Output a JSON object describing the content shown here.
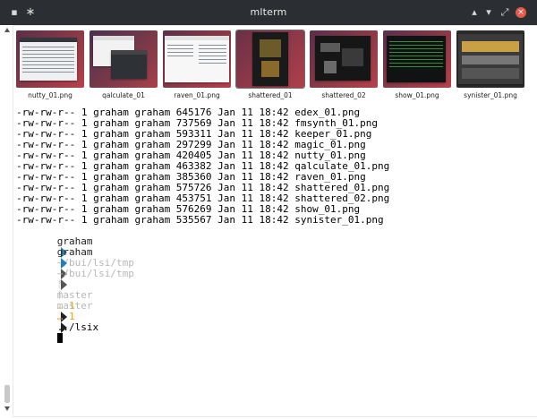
{
  "titlebar": {
    "title": "mlterm",
    "icons": [
      "app-menu-icon",
      "pin-icon",
      "chevron-up-icon",
      "chevron-down-icon",
      "restore-icon",
      "close-icon"
    ],
    "glyph_app": "▪",
    "glyph_pin": "∗",
    "glyph_up": "▴",
    "glyph_down": "▾",
    "glyph_restore": "⤢",
    "glyph_close": "×"
  },
  "thumbnails": [
    {
      "caption": "nutty_01.png"
    },
    {
      "caption": "qalculate_01"
    },
    {
      "caption": "raven_01.png"
    },
    {
      "caption": "shattered_01"
    },
    {
      "caption": "shattered_02"
    },
    {
      "caption": "show_01.png"
    },
    {
      "caption": "synister_01.png"
    }
  ],
  "listing": [
    "-rw-rw-r-- 1 graham graham 645176 Jan 11 18:42 edex_01.png",
    "-rw-rw-r-- 1 graham graham 737569 Jan 11 18:42 fmsynth_01.png",
    "-rw-rw-r-- 1 graham graham 593311 Jan 11 18:42 keeper_01.png",
    "-rw-rw-r-- 1 graham graham 297299 Jan 11 18:42 magic_01.png",
    "-rw-rw-r-- 1 graham graham 420405 Jan 11 18:42 nutty_01.png",
    "-rw-rw-r-- 1 graham graham 463382 Jan 11 18:42 qalculate_01.png",
    "-rw-rw-r-- 1 graham graham 385360 Jan 11 18:42 raven_01.png",
    "-rw-rw-r-- 1 graham graham 575726 Jan 11 18:42 shattered_01.png",
    "-rw-rw-r-- 1 graham graham 453751 Jan 11 18:42 shattered_02.png",
    "-rw-rw-r-- 1 graham graham 576269 Jan 11 18:42 show_01.png",
    "-rw-rw-r-- 1 graham graham 535567 Jan 11 18:42 synister_01.png"
  ],
  "prompts": [
    {
      "user": "graham",
      "path": "~/bui/lsi/tmp",
      "branch_icon": "ᚠ",
      "branch": "master",
      "dirty": "… 1",
      "command": "../lsix"
    },
    {
      "user": "graham",
      "path": "~/bui/lsi/tmp",
      "branch_icon": "ᚠ",
      "branch": "master",
      "dirty": "… 1",
      "command": ""
    }
  ],
  "colors": {
    "titlebar": "#2b2f33",
    "user": "#222222",
    "arrow_user": "#2a7fb0",
    "path": "#b8b8b8",
    "arrow_path": "#555555",
    "branch": "#b8b8b8",
    "dirty": "#e0a030",
    "arrow_end": "#222222"
  }
}
